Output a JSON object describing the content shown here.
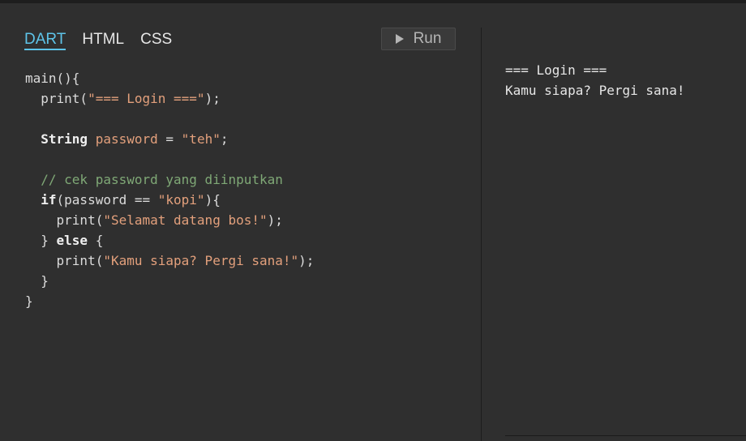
{
  "tabs": [
    {
      "label": "DART",
      "active": true
    },
    {
      "label": "HTML",
      "active": false
    },
    {
      "label": "CSS",
      "active": false
    }
  ],
  "run_button": {
    "label": "Run",
    "icon": "play-icon"
  },
  "code": {
    "line1": "main(){",
    "line2_fn": "  print(",
    "line2_str": "\"=== Login ===\"",
    "line2_end": ");",
    "line3": "",
    "line4_kw": "  String",
    "line4_id": " password",
    "line4_op": " = ",
    "line4_str": "\"teh\"",
    "line4_end": ";",
    "line5": "",
    "line6_cm": "  // cek password yang diinputkan",
    "line7_kw": "  if",
    "line7_mid": "(password == ",
    "line7_str": "\"kopi\"",
    "line7_end": "){",
    "line8_fn": "    print(",
    "line8_str": "\"Selamat datang bos!\"",
    "line8_end": ");",
    "line9_a": "  } ",
    "line9_kw": "else",
    "line9_b": " {",
    "line10_fn": "    print(",
    "line10_str": "\"Kamu siapa? Pergi sana!\"",
    "line10_end": ");",
    "line11": "  }",
    "line12": "}"
  },
  "output": {
    "line1": "=== Login ===",
    "line2": "Kamu siapa? Pergi sana!"
  },
  "colors": {
    "accent": "#5ec4e9",
    "background": "#2f2f2f",
    "string": "#e3a07c",
    "comment": "#7fa876"
  }
}
